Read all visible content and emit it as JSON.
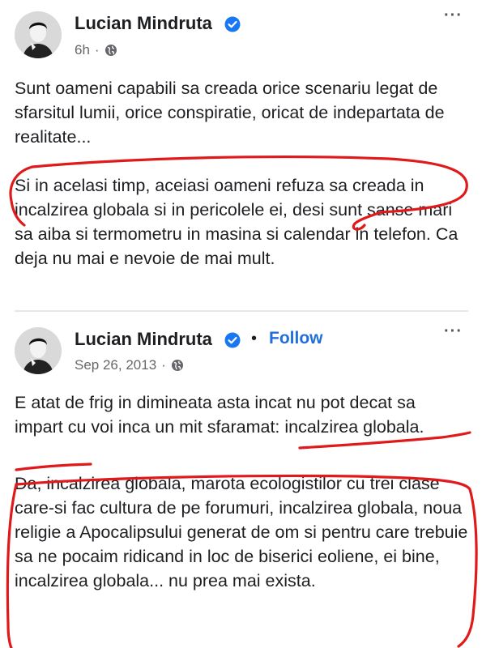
{
  "posts": [
    {
      "author": "Lucian Mindruta",
      "timestamp": "6h",
      "separator": "·",
      "verified": true,
      "privacy_icon": "globe-icon",
      "more_icon": "more-dots-icon",
      "paragraphs": [
        "Sunt oameni capabili sa creada orice scenariu legat de sfarsitul lumii, orice conspiratie, oricat de indepartata de realitate...",
        "Si in acelasi timp, aceiasi oameni refuza sa creada in incalzirea globala si in pericolele ei, desi sunt sanse mari sa aiba si termometru in masina si calendar in telefon. Ca deja nu mai e nevoie de mai mult."
      ]
    },
    {
      "author": "Lucian Mindruta",
      "timestamp": "Sep 26, 2013",
      "separator": "·",
      "verified": true,
      "follow_separator": "•",
      "follow_label": "Follow",
      "privacy_icon": "globe-icon",
      "more_icon": "more-dots-icon",
      "paragraphs": [
        "E atat de frig in dimineata asta incat nu pot decat sa impart cu voi inca un mit sfaramat: incalzirea globala.",
        "Da, incalzirea globala, marota ecologistilor cu trei clase care-si fac cultura de pe forumuri, incalzirea globala, noua religie a Apocalipsului generat de om si pentru care trebuie sa ne pocaim ridicand in loc de biserici eoliene, ei bine, incalzirea globala... nu prea mai exista."
      ]
    }
  ],
  "colors": {
    "text": "#1c1e21",
    "meta": "#65676b",
    "link": "#216fdb",
    "verified": "#1877f2",
    "marker": "#e0191b"
  }
}
